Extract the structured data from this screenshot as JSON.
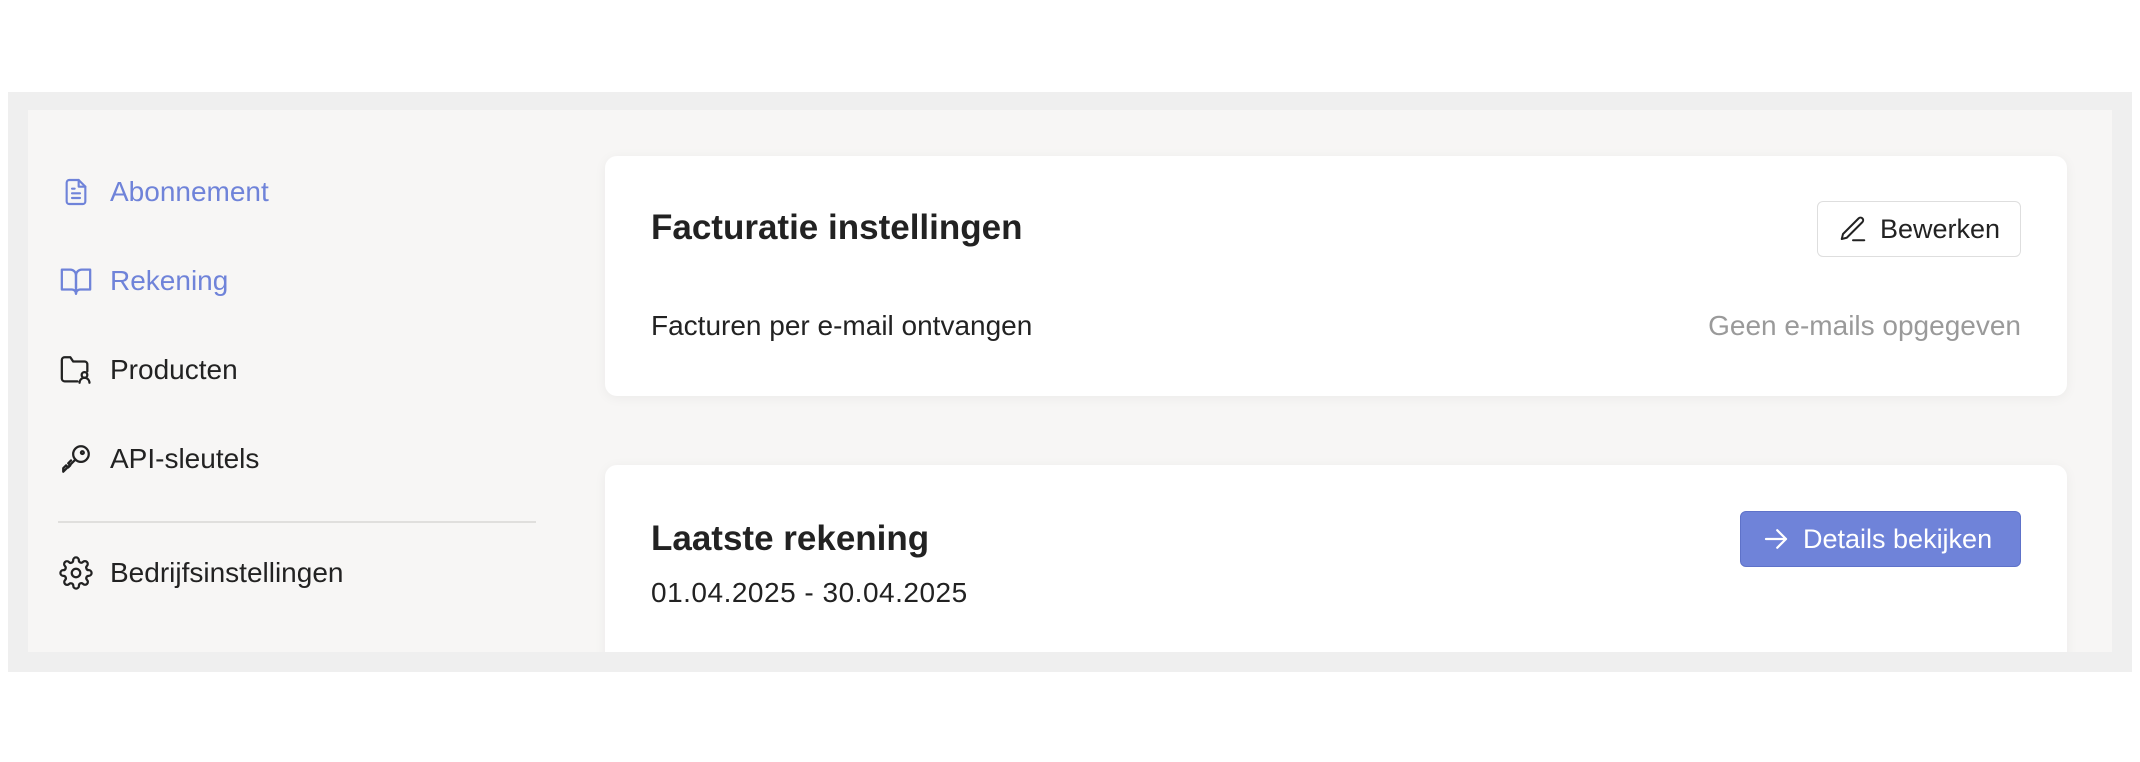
{
  "sidebar": {
    "items": [
      {
        "label": "Abonnement",
        "icon": "document-icon",
        "active": true
      },
      {
        "label": "Rekening",
        "icon": "book-open-icon",
        "active": true
      },
      {
        "label": "Producten",
        "icon": "folder-user-icon",
        "active": false
      },
      {
        "label": "API-sleutels",
        "icon": "key-icon",
        "active": false
      },
      {
        "label": "Bedrijfsinstellingen",
        "icon": "gear-icon",
        "active": false
      }
    ]
  },
  "billing_settings": {
    "title": "Facturatie instellingen",
    "edit_label": "Bewerken",
    "row_label": "Facturen per e-mail ontvangen",
    "row_value": "Geen e-mails opgegeven"
  },
  "latest_invoice": {
    "title": "Laatste rekening",
    "period": "01.04.2025 - 30.04.2025",
    "details_label": "Details bekijken"
  },
  "colors": {
    "accent": "#6f83d9",
    "text": "#222222",
    "muted": "#9a9a9a",
    "background": "#f7f6f5"
  }
}
